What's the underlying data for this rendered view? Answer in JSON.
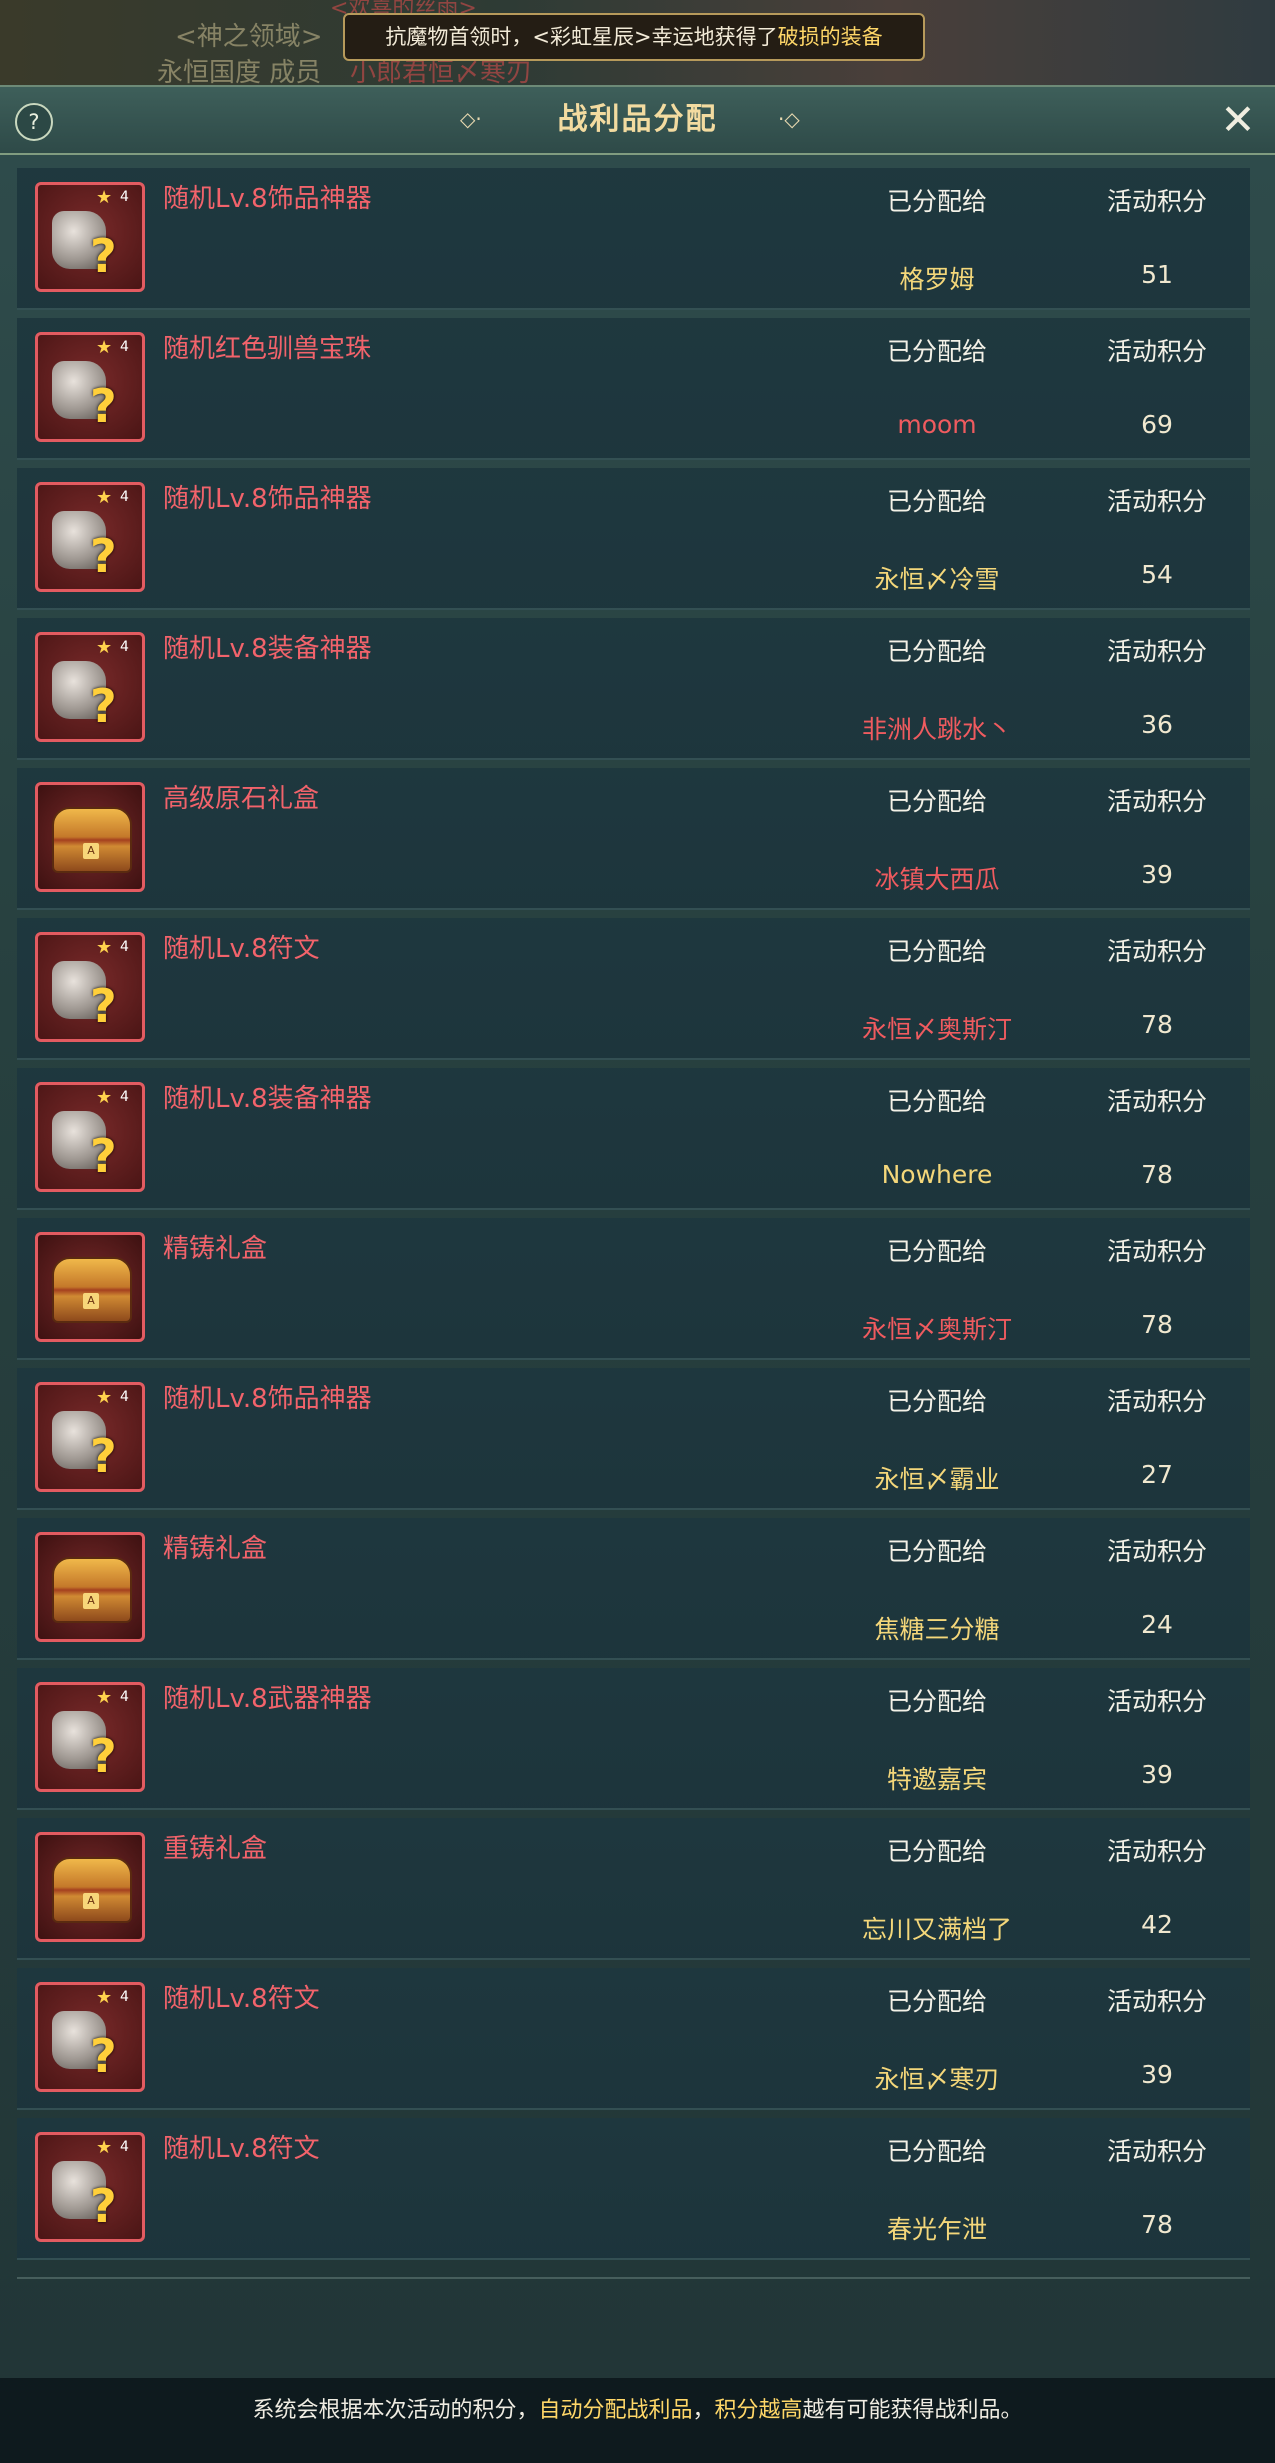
{
  "background": {
    "texts": [
      "<神之领域>",
      "永恒国度 成员",
      "小郎君恒〆寒刃",
      "<欢喜的丝雨>"
    ]
  },
  "banner": {
    "part1": "抗魔物首领时，<彩虹星辰>幸运地获得了",
    "part2": "破损的装备"
  },
  "header": {
    "help": "?",
    "title": "战利品分配",
    "close": "✕"
  },
  "items": [
    {
      "name": "随机Lv.8饰品神器",
      "icon": "accessory-artifact-icon",
      "assigned_label": "已分配给",
      "score_label": "活动积分",
      "player": "格罗姆",
      "player_color": "yellow",
      "points": "51"
    },
    {
      "name": "随机红色驯兽宝珠",
      "icon": "beast-orb-icon",
      "assigned_label": "已分配给",
      "score_label": "活动积分",
      "player": "moom",
      "player_color": "red",
      "points": "69"
    },
    {
      "name": "随机Lv.8饰品神器",
      "icon": "accessory-artifact-icon",
      "assigned_label": "已分配给",
      "score_label": "活动积分",
      "player": "永恒〆冷雪",
      "player_color": "yellow",
      "points": "54"
    },
    {
      "name": "随机Lv.8装备神器",
      "icon": "equipment-artifact-icon",
      "assigned_label": "已分配给",
      "score_label": "活动积分",
      "player": "非洲人跳水丶",
      "player_color": "red",
      "points": "36"
    },
    {
      "name": "高级原石礼盒",
      "icon": "treasure-chest-icon",
      "assigned_label": "已分配给",
      "score_label": "活动积分",
      "player": "冰镇大西瓜",
      "player_color": "red",
      "points": "39"
    },
    {
      "name": "随机Lv.8符文",
      "icon": "rune-icon",
      "assigned_label": "已分配给",
      "score_label": "活动积分",
      "player": "永恒〆奥斯汀",
      "player_color": "red",
      "points": "78"
    },
    {
      "name": "随机Lv.8装备神器",
      "icon": "equipment-artifact-icon",
      "assigned_label": "已分配给",
      "score_label": "活动积分",
      "player": "Nowhere",
      "player_color": "yellow",
      "points": "78"
    },
    {
      "name": "精铸礼盒",
      "icon": "treasure-chest-icon",
      "assigned_label": "已分配给",
      "score_label": "活动积分",
      "player": "永恒〆奥斯汀",
      "player_color": "red",
      "points": "78"
    },
    {
      "name": "随机Lv.8饰品神器",
      "icon": "accessory-artifact-icon",
      "assigned_label": "已分配给",
      "score_label": "活动积分",
      "player": "永恒〆霸业",
      "player_color": "yellow",
      "points": "27"
    },
    {
      "name": "精铸礼盒",
      "icon": "treasure-chest-icon",
      "assigned_label": "已分配给",
      "score_label": "活动积分",
      "player": "焦糖三分糖",
      "player_color": "yellow",
      "points": "24"
    },
    {
      "name": "随机Lv.8武器神器",
      "icon": "weapon-artifact-icon",
      "assigned_label": "已分配给",
      "score_label": "活动积分",
      "player": "特邀嘉宾",
      "player_color": "yellow",
      "points": "39"
    },
    {
      "name": "重铸礼盒",
      "icon": "treasure-chest-icon",
      "assigned_label": "已分配给",
      "score_label": "活动积分",
      "player": "忘川又满档了",
      "player_color": "yellow",
      "points": "42"
    },
    {
      "name": "随机Lv.8符文",
      "icon": "rune-icon",
      "assigned_label": "已分配给",
      "score_label": "活动积分",
      "player": "永恒〆寒刃",
      "player_color": "yellow",
      "points": "39"
    },
    {
      "name": "随机Lv.8符文",
      "icon": "rune-icon",
      "assigned_label": "已分配给",
      "score_label": "活动积分",
      "player": "春光乍泄",
      "player_color": "yellow",
      "points": "78"
    }
  ],
  "item_star_level": "4",
  "icon_question_mark": "?",
  "footer": {
    "part1": "系统会根据本次活动的积分，",
    "part2": "自动分配战利品",
    "part3": "，",
    "part4": "积分越高",
    "part5": "越有可能获得战利品。"
  },
  "colors": {
    "item_name": "#f2636b",
    "player_yellow": "#f4d77a",
    "player_red": "#ef5b5f",
    "title": "#f3dba0",
    "highlight": "#ffd768"
  }
}
